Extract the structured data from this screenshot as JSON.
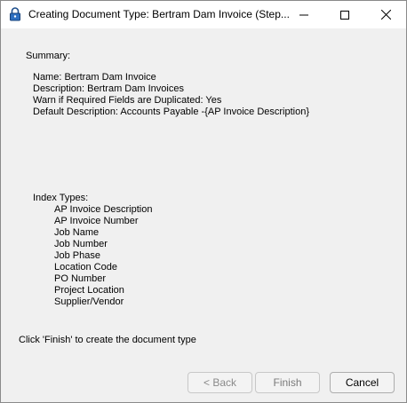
{
  "window": {
    "title": "Creating Document Type: Bertram Dam Invoice (Step...",
    "icon": "lock-icon"
  },
  "summary": {
    "label": "Summary:",
    "lines": [
      "Name: Bertram Dam Invoice",
      "Description: Bertram Dam Invoices",
      "Warn if Required Fields are Duplicated: Yes",
      "Default Description: Accounts Payable -{AP Invoice Description}"
    ]
  },
  "index": {
    "label": "Index Types:",
    "items": [
      "AP Invoice Description",
      "AP Invoice Number",
      "Job Name",
      "Job Number",
      "Job Phase",
      "Location Code",
      "PO Number",
      "Project Location",
      "Supplier/Vendor"
    ]
  },
  "hint": "Click 'Finish' to create the document type",
  "buttons": {
    "back": "< Back",
    "finish": "Finish",
    "cancel": "Cancel"
  }
}
